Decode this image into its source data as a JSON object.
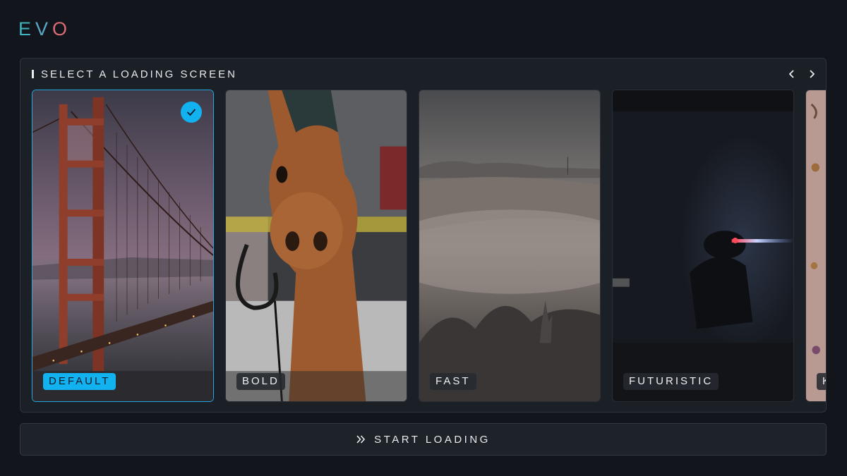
{
  "app": {
    "logo_letters": [
      "E",
      "V",
      "O"
    ],
    "logo_colors": [
      "#3fb3bd",
      "#5aa7c6",
      "#d96b73"
    ]
  },
  "panel": {
    "title": "SELECT A LOADING SCREEN",
    "prev_icon": "chevron-left-icon",
    "next_icon": "chevron-right-icon"
  },
  "cards": [
    {
      "label": "DEFAULT",
      "selected": true,
      "image": "golden-gate-bridge-dusk"
    },
    {
      "label": "BOLD",
      "selected": false,
      "image": "carousel-horse"
    },
    {
      "label": "FAST",
      "selected": false,
      "image": "foggy-hills"
    },
    {
      "label": "FUTURISTIC",
      "selected": false,
      "image": "dark-figure-red-blue-light"
    },
    {
      "label": "K",
      "selected": false,
      "image": "pink-floral"
    }
  ],
  "start_button": {
    "label": "START LOADING",
    "icon": "double-chevron-right-icon"
  },
  "colors": {
    "accent": "#12b1f0",
    "background": "#12161c",
    "panel": "#1b1f26"
  }
}
